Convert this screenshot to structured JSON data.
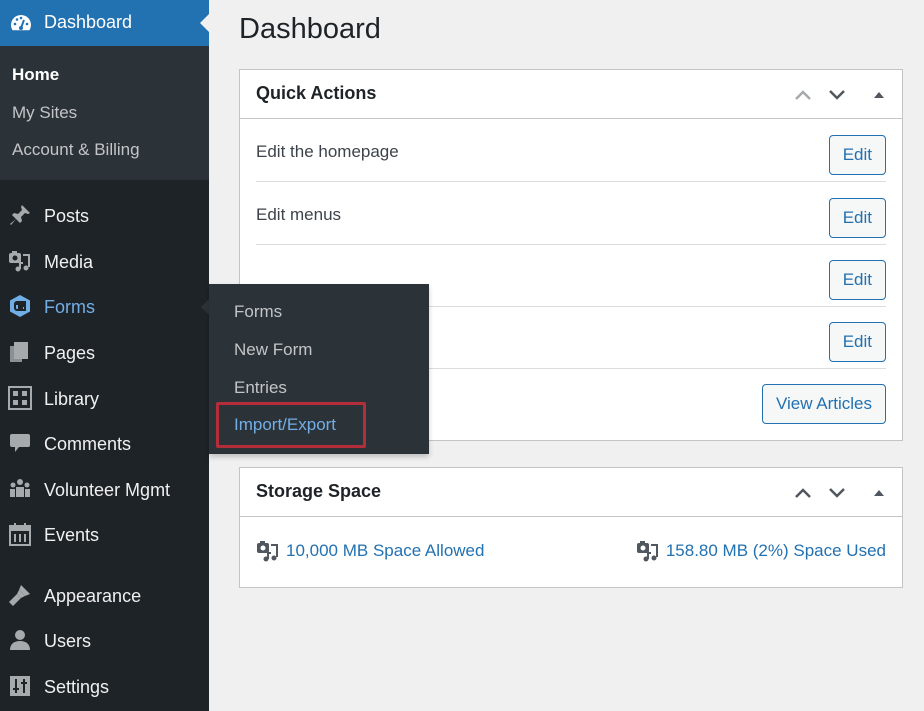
{
  "sidebar": {
    "dashboard": {
      "label": "Dashboard",
      "icon": "dashboard-icon"
    },
    "dashboard_submenu": [
      {
        "label": "Home",
        "current": true
      },
      {
        "label": "My Sites"
      },
      {
        "label": "Account & Billing"
      }
    ],
    "items": [
      {
        "label": "Posts",
        "icon": "pin-icon"
      },
      {
        "label": "Media",
        "icon": "media-icon"
      },
      {
        "label": "Forms",
        "icon": "gravity-forms-icon",
        "active_hover": true
      },
      {
        "label": "Pages",
        "icon": "pages-icon"
      },
      {
        "label": "Library",
        "icon": "grid-icon"
      },
      {
        "label": "Comments",
        "icon": "comment-icon"
      },
      {
        "label": "Volunteer Mgmt",
        "icon": "groups-icon"
      },
      {
        "label": "Events",
        "icon": "calendar-icon"
      },
      {
        "label": "Appearance",
        "icon": "paintbrush-icon"
      },
      {
        "label": "Users",
        "icon": "user-icon"
      },
      {
        "label": "Settings",
        "icon": "settings-icon"
      }
    ]
  },
  "flyout": {
    "items": [
      {
        "label": "Forms"
      },
      {
        "label": "New Form"
      },
      {
        "label": "Entries"
      },
      {
        "label": "Import/Export",
        "highlighted": true
      }
    ]
  },
  "main": {
    "title": "Dashboard",
    "quick_actions": {
      "title": "Quick Actions",
      "rows": [
        {
          "text": "Edit the homepage",
          "button": "Edit"
        },
        {
          "text": "Edit menus",
          "button": "Edit"
        },
        {
          "text": "",
          "button": "Edit"
        },
        {
          "text": "",
          "button": "Edit"
        },
        {
          "text": "",
          "button": "View Articles"
        }
      ]
    },
    "storage": {
      "title": "Storage Space",
      "allowed": "10,000 MB Space Allowed",
      "used": "158.80 MB (2%) Space Used"
    }
  },
  "colors": {
    "accent": "#2271b1",
    "sidebar_bg": "#1d2327",
    "submenu_bg": "#2c3338",
    "highlight_link": "#72aee6",
    "highlight_box": "#b32d3a"
  }
}
